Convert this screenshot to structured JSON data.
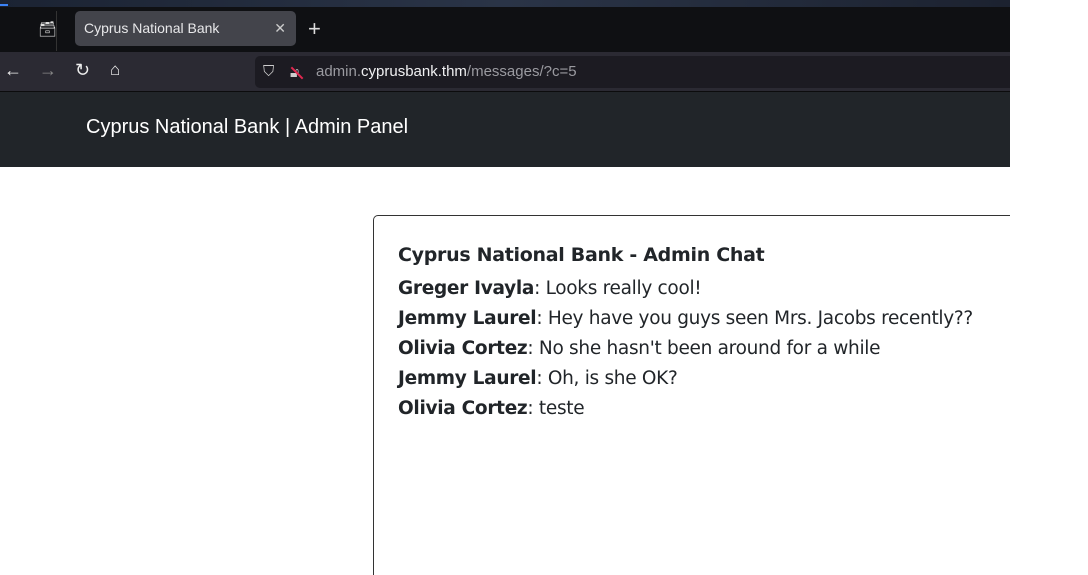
{
  "browser": {
    "tab_title": "Cyprus National Bank",
    "url_prefix": "admin.",
    "url_domain": "cyprusbank.thm",
    "url_path": "/messages/?c=5"
  },
  "header": {
    "brand": "Cyprus National Bank | Admin Panel"
  },
  "chat": {
    "title": "Cyprus National Bank - Admin Chat",
    "messages": [
      {
        "author": "Greger Ivayla",
        "text": ": Looks really cool!"
      },
      {
        "author": "Jemmy Laurel",
        "text": ": Hey have you guys seen Mrs. Jacobs recently??"
      },
      {
        "author": "Olivia Cortez",
        "text": ": No she hasn't been around for a while"
      },
      {
        "author": "Jemmy Laurel",
        "text": ": Oh, is she OK?"
      },
      {
        "author": "Olivia Cortez",
        "text": ": teste"
      }
    ]
  }
}
